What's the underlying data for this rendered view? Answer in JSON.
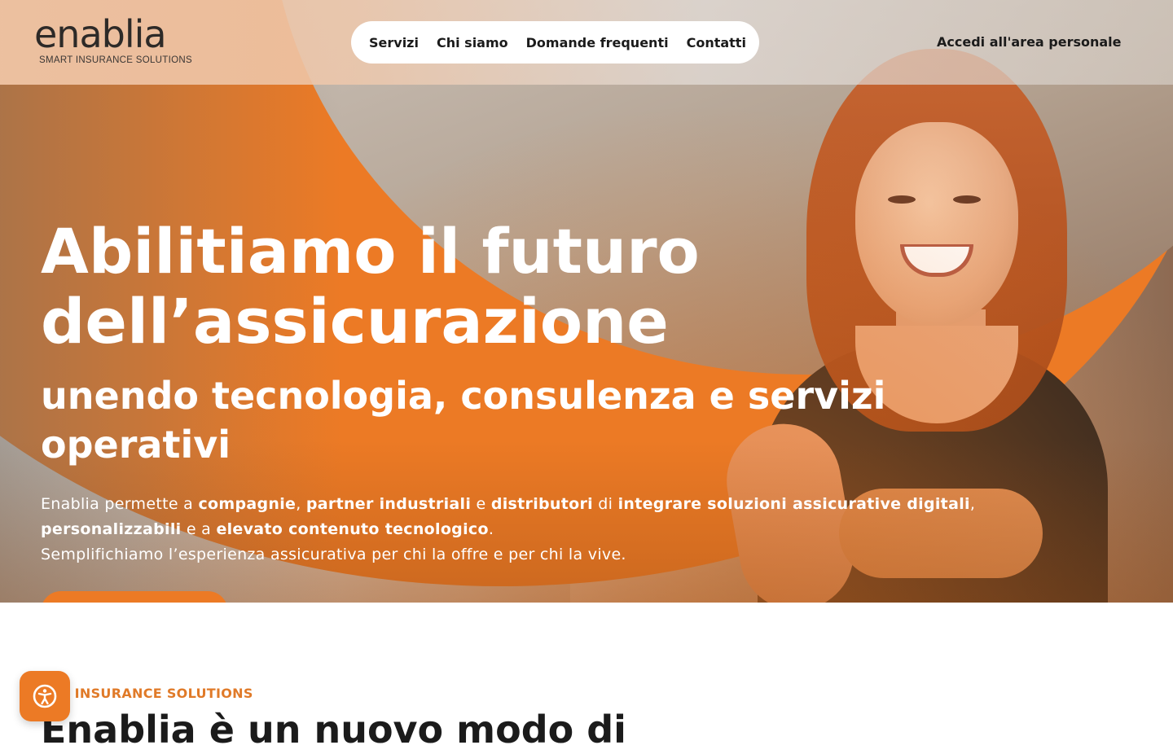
{
  "header": {
    "logo_word": "enablia",
    "logo_tagline": "SMART INSURANCE SOLUTIONS",
    "nav": [
      {
        "label": "Servizi"
      },
      {
        "label": "Chi siamo"
      },
      {
        "label": "Domande frequenti"
      },
      {
        "label": "Contatti"
      }
    ],
    "login_label": "Accedi all'area personale"
  },
  "hero": {
    "title": "Abilitiamo il futuro dell’assicurazione",
    "subtitle": "unendo tecnologia, consulenza e servizi operativi",
    "lead": {
      "t1": "Enablia permette a ",
      "b1": "compagnie",
      "t2": ", ",
      "b2": "partner industriali",
      "t3": " e ",
      "b3": "distributori",
      "t4": " di ",
      "b4": "integrare soluzioni assicurative digitali",
      "t5": ", ",
      "b5": "personalizzabili",
      "t6": " e a ",
      "b6": "elevato contenuto tecnologico",
      "t7": ".",
      "line2": "Semplifichiamo l’esperienza assicurativa per chi la offre e per chi la vive."
    }
  },
  "about": {
    "kicker": "ART INSURANCE SOLUTIONS",
    "title": "Enablia è un nuovo modo di"
  },
  "accessibility": {
    "icon": "accessibility-icon"
  },
  "colors": {
    "accent": "#ec7a25",
    "text_dark": "#1b1b1b"
  }
}
